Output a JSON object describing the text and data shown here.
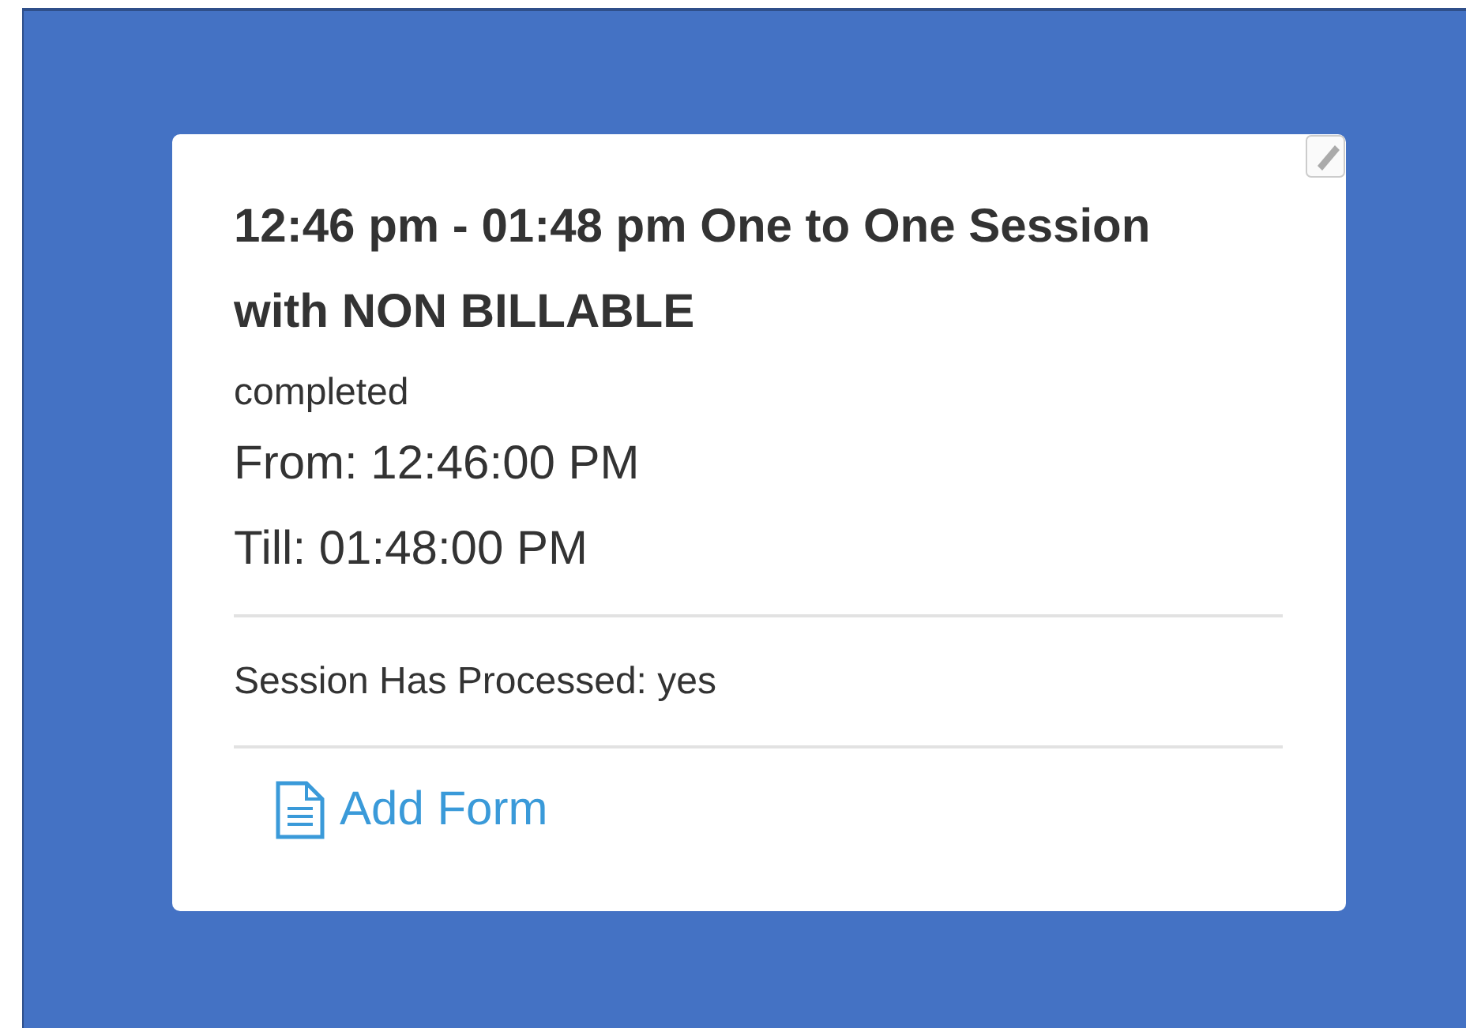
{
  "event": {
    "title": "12:46 pm - 01:48 pm One to One Session with NON BILLABLE",
    "status": "completed",
    "from": "From: 12:46:00 PM",
    "till": "Till: 01:48:00 PM",
    "processed": "Session Has Processed: yes",
    "action": "Add Form"
  }
}
